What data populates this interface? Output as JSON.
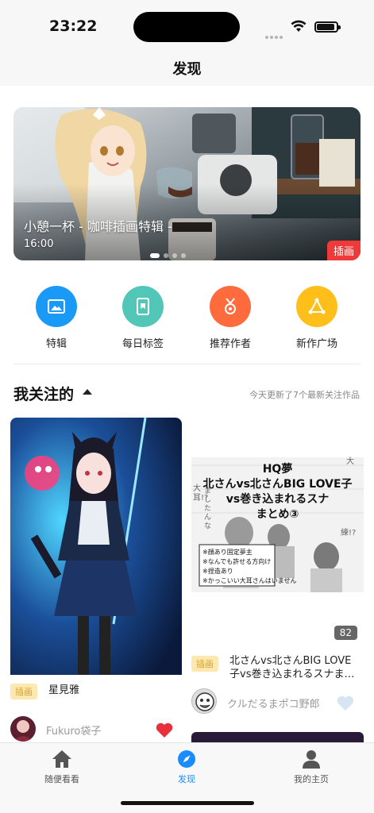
{
  "status_bar": {
    "time": "23:22",
    "icons": [
      "signal-icon",
      "wifi-icon",
      "battery-icon"
    ]
  },
  "nav": {
    "title": "发现"
  },
  "banner": {
    "title": "小憩一杯 - 咖啡插画特辑 -",
    "time": "16:00",
    "tag": "插画"
  },
  "quick_entries": [
    {
      "label": "特辑",
      "icon": "image-icon",
      "color": "#1a9af7"
    },
    {
      "label": "每日标签",
      "icon": "bookmark-icon",
      "color": "#52c7b8"
    },
    {
      "label": "推荐作者",
      "icon": "medal-icon",
      "color": "#ff6b3d"
    },
    {
      "label": "新作广场",
      "icon": "triangle-icon",
      "color": "#ffbf1a"
    }
  ],
  "following": {
    "title": "我关注的",
    "note": "今天更新了7个最新关注作品"
  },
  "feed": [
    {
      "tag": "插画",
      "title": "星見雅",
      "author": "Fukuro袋子",
      "liked": true
    },
    {
      "tag": "插画",
      "title": "北さんvs北さんBIG LOVE子vs巻き込まれるスナま…",
      "author": "クルだるまポコ野郎",
      "liked": false,
      "page_count": "82",
      "manga_cover": {
        "line1": "HQ夢",
        "line2": "北さんvs北さんBIG LOVE子",
        "line3": "vs巻き込まれるスナ",
        "line4": "まとめ③",
        "notes": [
          "※顔あり固定夢主",
          "※なんでも許せる方向け",
          "※捏造あり",
          "※かっこいい大耳さんはいません"
        ],
        "side_left": "大耳!?",
        "side_right": "大",
        "side_right2": "練!?",
        "side_vert": "ましたんな"
      }
    }
  ],
  "tabbar": [
    {
      "label": "随便看看",
      "icon": "house-icon",
      "active": false
    },
    {
      "label": "发现",
      "icon": "compass-icon",
      "active": true
    },
    {
      "label": "我的主页",
      "icon": "person-icon",
      "active": false
    }
  ]
}
